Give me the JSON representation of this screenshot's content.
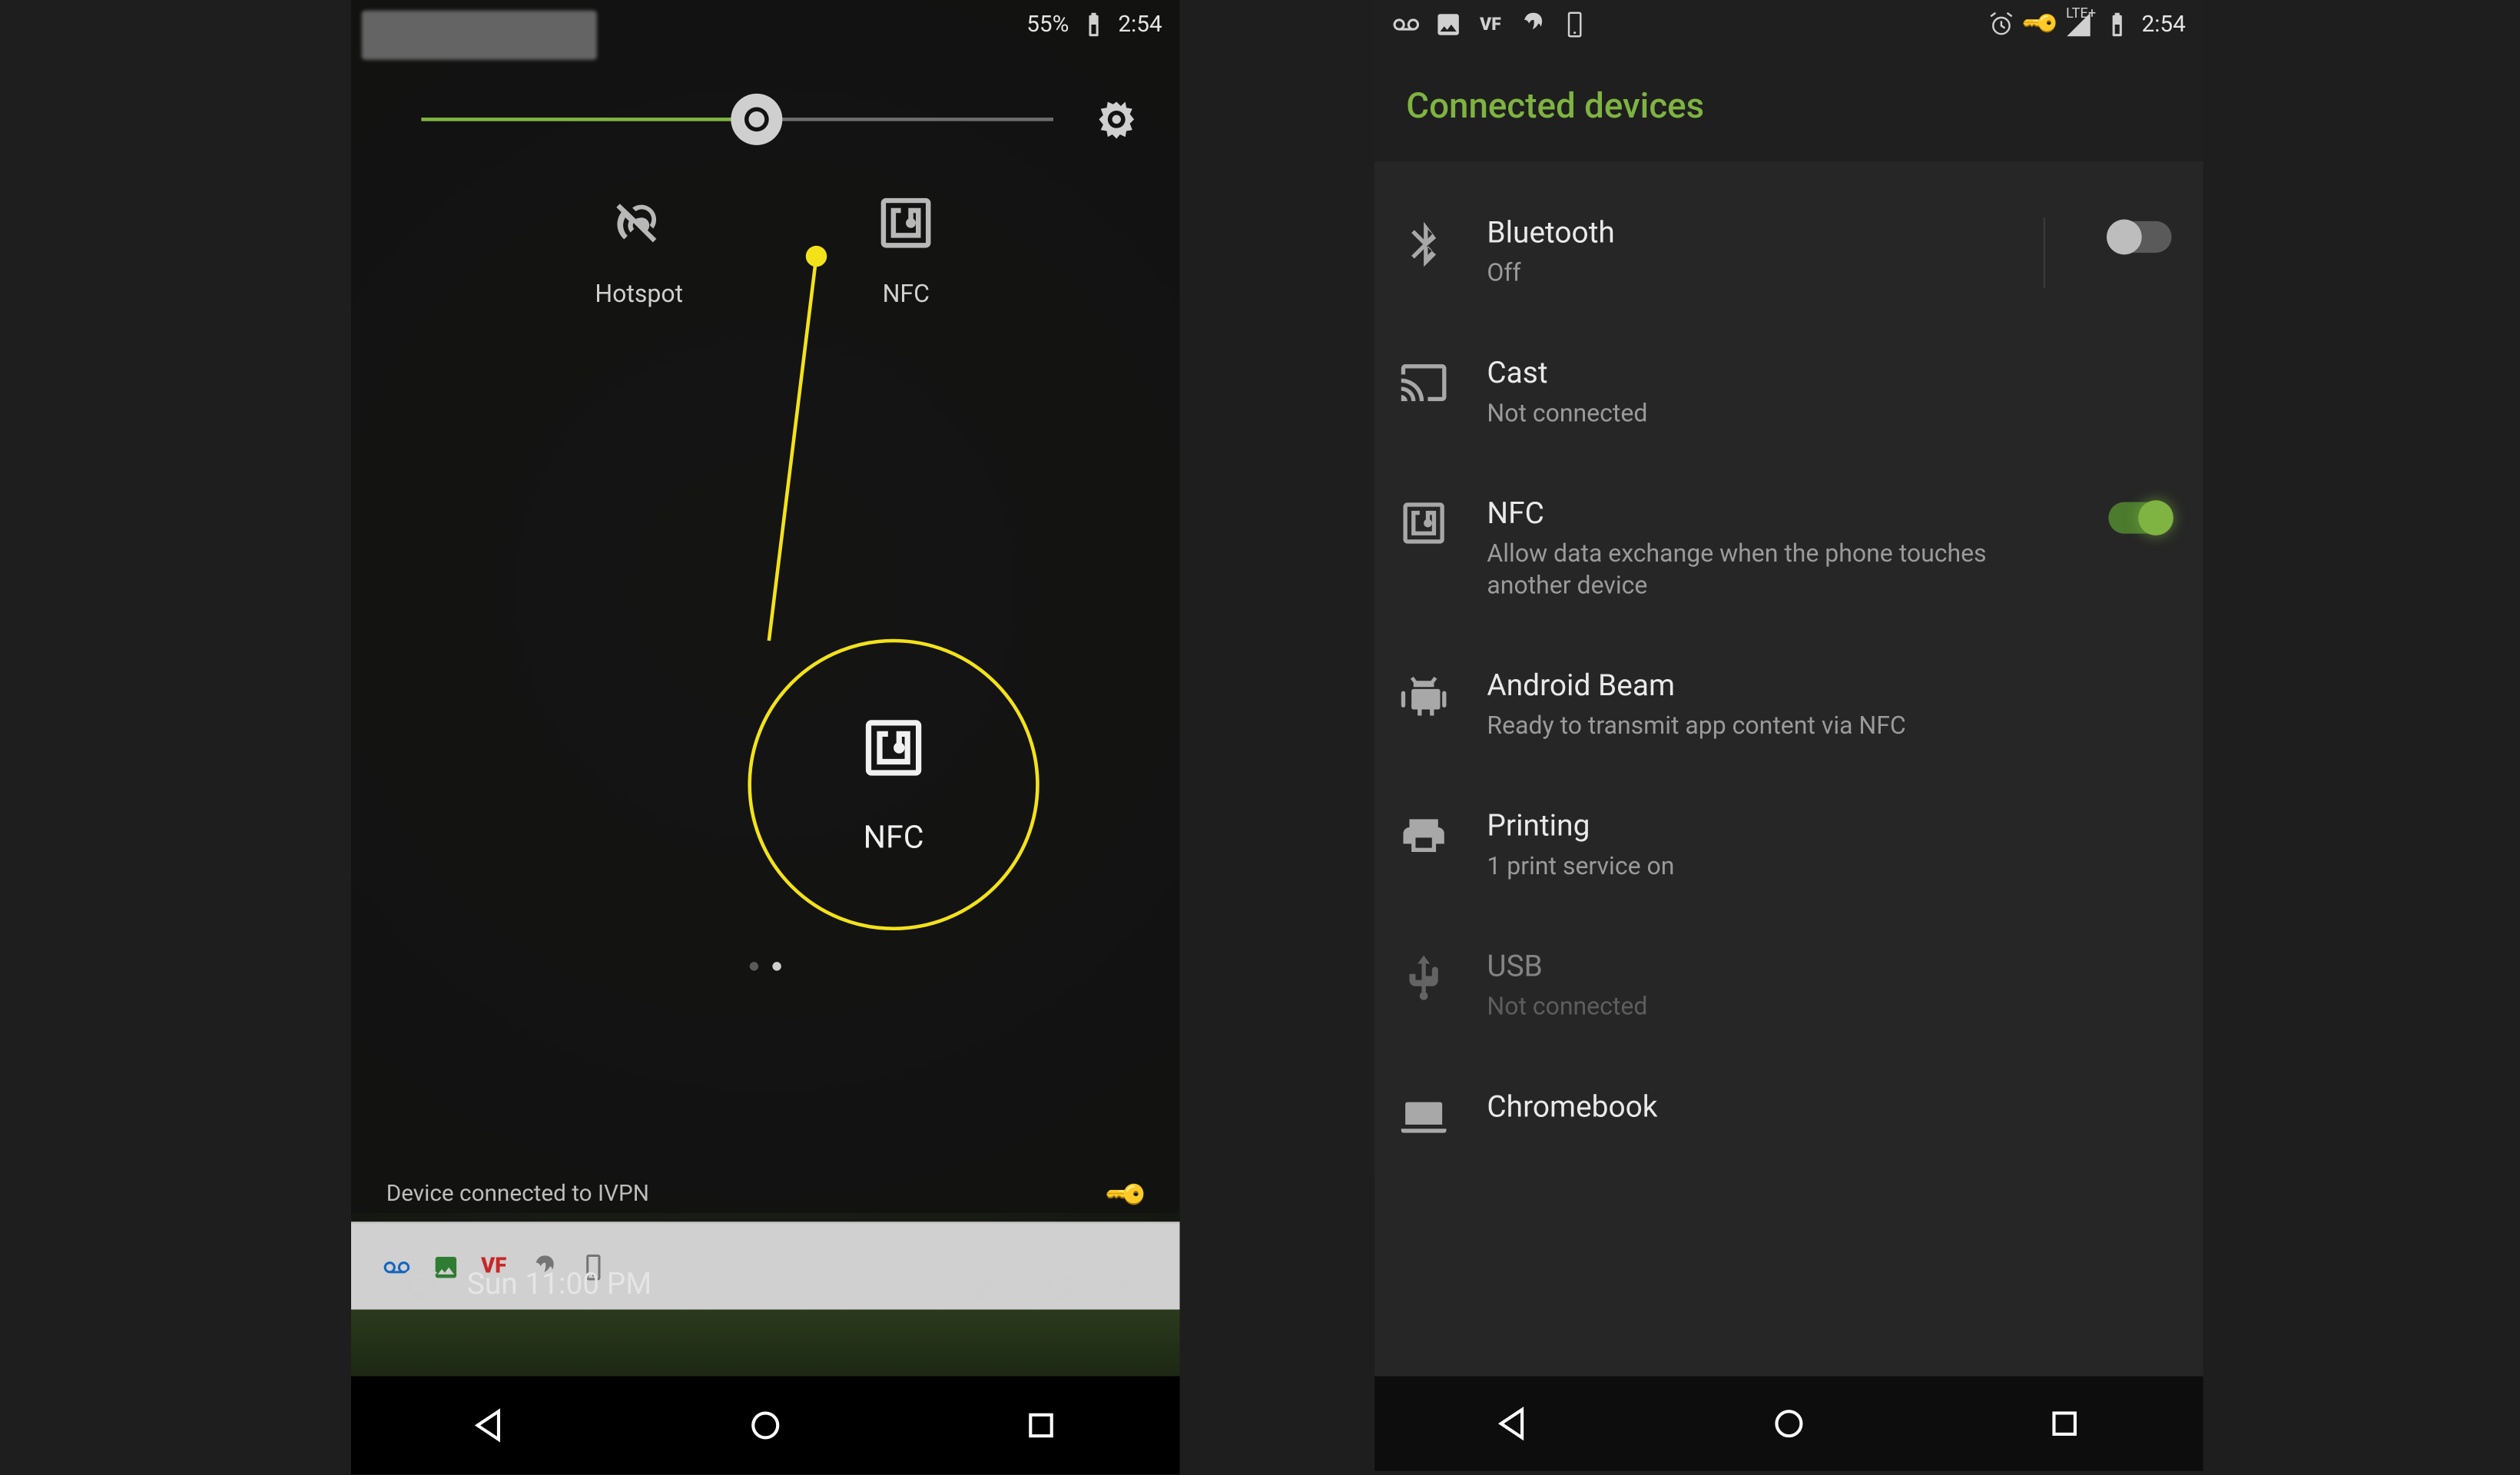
{
  "left": {
    "status": {
      "battery_pct": "55%",
      "time": "2:54"
    },
    "brightness": {
      "value_pct": 53
    },
    "tiles": {
      "hotspot": {
        "label": "Hotspot"
      },
      "nfc": {
        "label": "NFC"
      }
    },
    "pager": {
      "current": 1,
      "total": 2
    },
    "vpn_text": "Device connected to IVPN",
    "alarm_text": "Sun 11:00 PM",
    "callout_label": "NFC"
  },
  "right": {
    "status": {
      "time": "2:54",
      "signal_label": "LTE+"
    },
    "header_title": "Connected devices",
    "items": [
      {
        "title": "Bluetooth",
        "sub": "Off",
        "switch": "off"
      },
      {
        "title": "Cast",
        "sub": "Not connected"
      },
      {
        "title": "NFC",
        "sub": "Allow data exchange when the phone touches another device",
        "switch": "on"
      },
      {
        "title": "Android Beam",
        "sub": "Ready to transmit app content via NFC"
      },
      {
        "title": "Printing",
        "sub": "1 print service on"
      },
      {
        "title": "USB",
        "sub": "Not connected",
        "disabled": true
      },
      {
        "title": "Chromebook"
      }
    ]
  },
  "colors": {
    "accent": "#7fb342",
    "callout": "#f3e21a"
  }
}
